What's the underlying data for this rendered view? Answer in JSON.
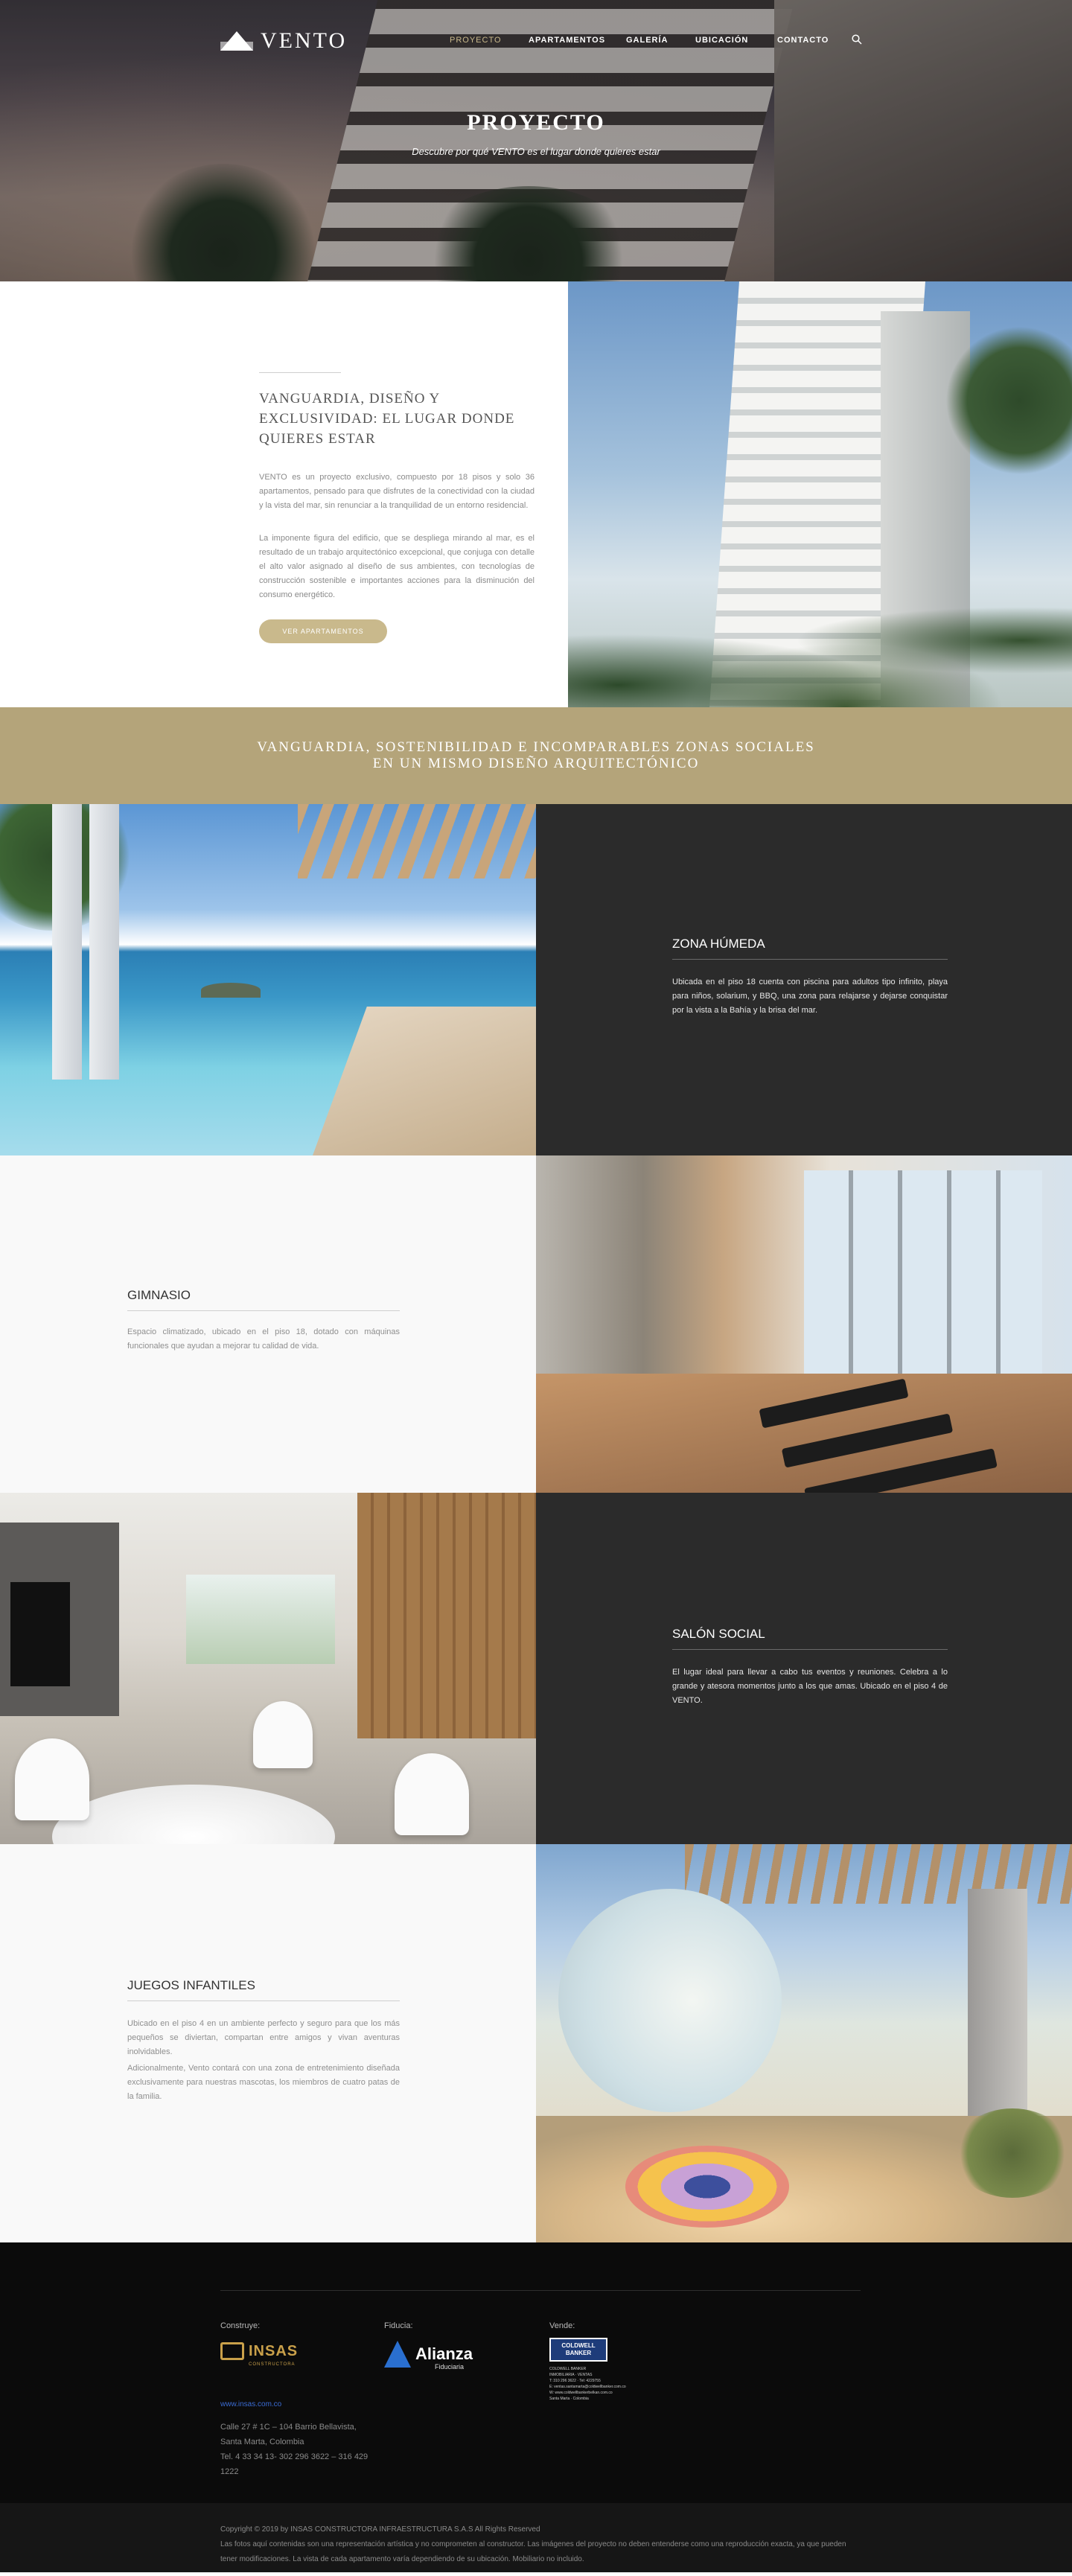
{
  "brand": {
    "logo_text": "VENTO"
  },
  "nav": {
    "items": [
      {
        "label": "PROYECTO",
        "active": true
      },
      {
        "label": "APARTAMENTOS",
        "active": false
      },
      {
        "label": "GALERÍA",
        "active": false
      },
      {
        "label": "UBICACIÓN",
        "active": false
      },
      {
        "label": "CONTACTO",
        "active": false
      }
    ],
    "search_icon": "search-icon"
  },
  "hero": {
    "title": "PROYECTO",
    "subtitle": "Descubre por qué VENTO es el lugar donde quieres estar"
  },
  "intro": {
    "heading": "VANGUARDIA, DISEÑO Y EXCLUSIVIDAD: EL LUGAR DONDE QUIERES ESTAR",
    "paragraph_1": "VENTO es un proyecto exclusivo, compuesto por 18 pisos y solo 36 apartamentos, pensado para que disfrutes de la conectividad con la ciudad y la vista del mar, sin renunciar a la tranquilidad de un entorno residencial.",
    "paragraph_2": "La imponente figura del edificio, que se despliega mirando al mar, es el resultado de un trabajo arquitectónico excepcional, que conjuga con detalle el alto valor asignado al diseño de sus ambientes, con tecnologías de construcción sostenible e importantes acciones para la disminución del consumo energético.",
    "button_label": "VER APARTAMENTOS"
  },
  "banner": {
    "line_1": "VANGUARDIA, SOSTENIBILIDAD E INCOMPARABLES ZONAS SOCIALES",
    "line_2": "EN UN MISMO DISEÑO ARQUITECTÓNICO"
  },
  "features": [
    {
      "title": "ZONA HÚMEDA",
      "text": "Ubicada en el piso 18 cuenta con piscina para adultos tipo infinito, playa para niños, solarium, y BBQ, una zona para relajarse y dejarse conquistar por la vista a la Bahía y la brisa del mar."
    },
    {
      "title": "GIMNASIO",
      "text": "Espacio climatizado, ubicado en el piso 18, dotado con máquinas funcionales que ayudan a mejorar tu calidad de vida."
    },
    {
      "title": "SALÓN SOCIAL",
      "text": "El lugar ideal para llevar a cabo tus eventos y reuniones. Celebra a lo grande y atesora momentos junto a los que amas. Ubicado en el piso 4 de VENTO."
    },
    {
      "title": "JUEGOS INFANTILES",
      "text_1": "Ubicado en el piso 4 en un ambiente perfecto y seguro para que los más pequeños se diviertan, compartan entre amigos y vivan aventuras inolvidables.",
      "text_2": "Adicionalmente, Vento contará con una zona de entretenimiento diseñada exclusivamente para nuestras mascotas, los miembros de cuatro patas de la familia."
    }
  ],
  "footer": {
    "construye_label": "Construye:",
    "fiducia_label": "Fiducia:",
    "vende_label": "Vende:",
    "insas_logo": "INSAS",
    "insas_sub": "CONSTRUCTORA",
    "alianza_logo": "Alianza",
    "alianza_sub": "Fiduciaria",
    "coldwell_logo": "COLDWELL BANKER",
    "coldwell_lines": "COLDWELL BANKER\nINMOBILIARIA · VENTAS\nT: 310 296 3622 · Tel: 4229755\nE: ventas.santamarta@coldwellbanker.com.co\nW: www.coldwellbankerbelkan.com.co\nSanta Marta · Colombia",
    "website": "www.insas.com.co",
    "address_1": "Calle 27 # 1C – 104 Barrio Bellavista,",
    "address_2": "Santa Marta, Colombia",
    "phone": "Tel. 4 33 34 13- 302 296 3622 – 316 429 1222",
    "copyright": "Copyright © 2019 by INSAS CONSTRUCTORA INFRAESTRUCTURA S.A.S All Rights Reserved",
    "disclaimer": "Las fotos aquí contenidas son una representación artística y no comprometen al constructor. Las imágenes del proyecto no deben entenderse como una reproducción exacta, ya que pueden tener modificaciones. La vista de cada apartamento varía dependiendo de su ubicación. Mobiliario no incluido."
  }
}
